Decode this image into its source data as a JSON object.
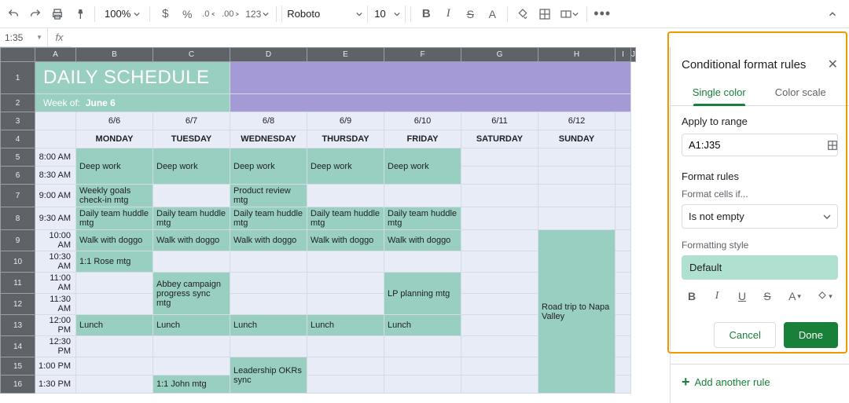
{
  "toolbar": {
    "zoom": "100%",
    "font": "Roboto",
    "font_size": "10",
    "decimal_dec": ".0",
    "decimal_inc": ".00",
    "num_format": "123"
  },
  "namebox": "1:35",
  "sidebar": {
    "title": "Conditional format rules",
    "tab_single": "Single color",
    "tab_scale": "Color scale",
    "apply_label": "Apply to range",
    "range_value": "A1:J35",
    "rules_label": "Format rules",
    "cells_if_label": "Format cells if...",
    "condition": "Is not empty",
    "style_label": "Formatting style",
    "style_preview": "Default",
    "cancel": "Cancel",
    "done": "Done",
    "add_rule": "Add another rule"
  },
  "schedule": {
    "title": "DAILY SCHEDULE",
    "week_of_label": "Week of:",
    "week_of_value": "June 6",
    "columns": [
      "A",
      "B",
      "C",
      "D",
      "E",
      "F",
      "G",
      "H",
      "I",
      "J"
    ],
    "row_numbers": [
      1,
      2,
      3,
      4,
      5,
      6,
      7,
      8,
      9,
      10,
      11,
      12,
      13,
      14,
      15,
      16
    ],
    "dates": [
      "6/6",
      "6/7",
      "6/8",
      "6/9",
      "6/10",
      "6/11",
      "6/12"
    ],
    "days": [
      "MONDAY",
      "TUESDAY",
      "WEDNESDAY",
      "THURSDAY",
      "FRIDAY",
      "SATURDAY",
      "SUNDAY"
    ],
    "times": [
      "8:00 AM",
      "8:30 AM",
      "9:00 AM",
      "9:30 AM",
      "10:00 AM",
      "10:30 AM",
      "11:00 AM",
      "11:30 AM",
      "12:00 PM",
      "12:30 PM",
      "1:00 PM",
      "1:30 PM"
    ],
    "events": {
      "deep_work": "Deep work",
      "weekly_goals": "Weekly goals check-in mtg",
      "product_review": "Product review mtg",
      "daily_huddle": "Daily team huddle mtg",
      "walk": "Walk with doggo",
      "rose": "1:1 Rose mtg",
      "abbey": "Abbey campaign progress sync mtg",
      "lp": "LP planning mtg",
      "lunch": "Lunch",
      "okrs": "Leadership OKRs sync",
      "john": "1:1 John mtg",
      "trip": "Road trip to Napa Valley"
    }
  }
}
